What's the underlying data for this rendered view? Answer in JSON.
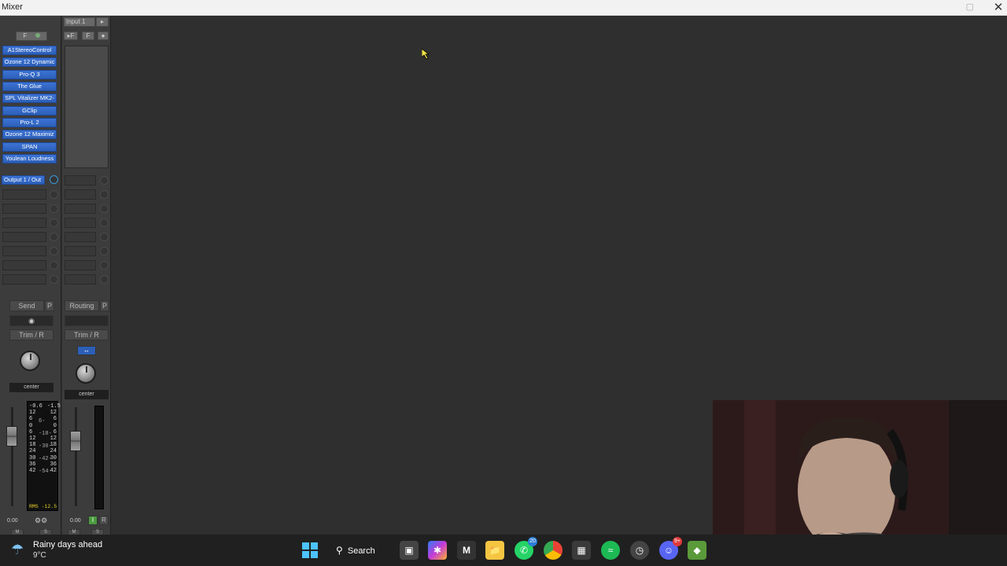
{
  "window": {
    "title": "Mixer"
  },
  "strip1": {
    "top_btn": "F",
    "inserts": [
      "A1StereoControl",
      "Ozone 12 Dynamic",
      "Pro-Q 3",
      "The Glue",
      "SPL Vitalizer MK2-",
      "GClip",
      "Pro-L 2",
      "Ozone 12 Maximiz",
      "SPAN",
      "Youlean Loudness"
    ],
    "output": "Output 1 / Out",
    "send": "Send",
    "p": "P",
    "trim": "Trim / R",
    "pan": "center",
    "vol": "0.00",
    "meter_scale_left": [
      "-0.6",
      "12",
      "6",
      "0",
      "6",
      "12",
      "18",
      "24",
      "30",
      "36",
      "42"
    ],
    "meter_scale_mid": [
      "6-",
      "-18-",
      "-30-",
      "-42-",
      "-54-"
    ],
    "meter_scale_right": [
      "-1.5",
      "12",
      "6",
      "0",
      "6",
      "12",
      "18",
      "24",
      "30",
      "36",
      "42"
    ],
    "rms": "RMS -12.5",
    "m": "M",
    "s": "S"
  },
  "strip2": {
    "input": "Input 1",
    "f1": "▸F",
    "f2": "F",
    "routing": "Routing",
    "p": "P",
    "trim": "Trim / R",
    "pan": "center",
    "vol": "0.00",
    "i": "I",
    "r": "R",
    "m": "M",
    "s": "S"
  },
  "taskbar": {
    "weather_title": "Rainy days ahead",
    "weather_temp": "9°C",
    "search": "Search",
    "whatsapp_badge": "20",
    "discord_badge": "9+"
  },
  "colors": {
    "insert": "#3c73d4",
    "accent": "#3a9ad9"
  }
}
